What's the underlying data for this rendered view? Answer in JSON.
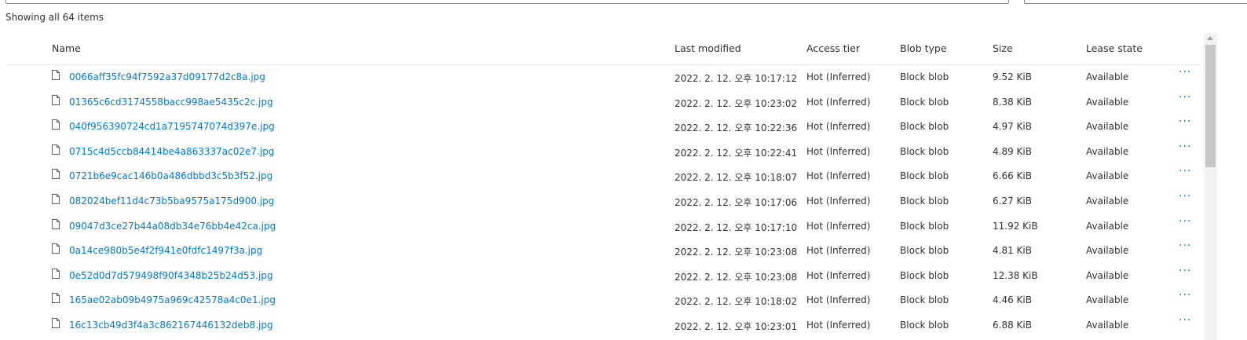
{
  "summary": "Showing all 64 items",
  "columns": {
    "name": "Name",
    "last_modified": "Last modified",
    "access_tier": "Access tier",
    "blob_type": "Blob type",
    "size": "Size",
    "lease_state": "Lease state"
  },
  "rows": [
    {
      "name": "0066aff35fc94f7592a37d09177d2c8a.jpg",
      "modified": "2022. 2. 12. 오후 10:17:12",
      "tier": "Hot (Inferred)",
      "type": "Block blob",
      "size": "9.52 KiB",
      "lease": "Available",
      "more": "···"
    },
    {
      "name": "01365c6cd3174558bacc998ae5435c2c.jpg",
      "modified": "2022. 2. 12. 오후 10:23:02",
      "tier": "Hot (Inferred)",
      "type": "Block blob",
      "size": "8.38 KiB",
      "lease": "Available",
      "more": "···"
    },
    {
      "name": "040f956390724cd1a7195747074d397e.jpg",
      "modified": "2022. 2. 12. 오후 10:22:36",
      "tier": "Hot (Inferred)",
      "type": "Block blob",
      "size": "4.97 KiB",
      "lease": "Available",
      "more": "···"
    },
    {
      "name": "0715c4d5ccb84414be4a863337ac02e7.jpg",
      "modified": "2022. 2. 12. 오후 10:22:41",
      "tier": "Hot (Inferred)",
      "type": "Block blob",
      "size": "4.89 KiB",
      "lease": "Available",
      "more": "···"
    },
    {
      "name": "0721b6e9cac146b0a486dbbd3c5b3f52.jpg",
      "modified": "2022. 2. 12. 오후 10:18:07",
      "tier": "Hot (Inferred)",
      "type": "Block blob",
      "size": "6.66 KiB",
      "lease": "Available",
      "more": "···"
    },
    {
      "name": "082024bef11d4c73b5ba9575a175d900.jpg",
      "modified": "2022. 2. 12. 오후 10:17:06",
      "tier": "Hot (Inferred)",
      "type": "Block blob",
      "size": "6.27 KiB",
      "lease": "Available",
      "more": "···"
    },
    {
      "name": "09047d3ce27b44a08db34e76bb4e42ca.jpg",
      "modified": "2022. 2. 12. 오후 10:17:10",
      "tier": "Hot (Inferred)",
      "type": "Block blob",
      "size": "11.92 KiB",
      "lease": "Available",
      "more": "···"
    },
    {
      "name": "0a14ce980b5e4f2f941e0fdfc1497f3a.jpg",
      "modified": "2022. 2. 12. 오후 10:23:08",
      "tier": "Hot (Inferred)",
      "type": "Block blob",
      "size": "4.81 KiB",
      "lease": "Available",
      "more": "···"
    },
    {
      "name": "0e52d0d7d579498f90f4348b25b24d53.jpg",
      "modified": "2022. 2. 12. 오후 10:23:08",
      "tier": "Hot (Inferred)",
      "type": "Block blob",
      "size": "12.38 KiB",
      "lease": "Available",
      "more": "···"
    },
    {
      "name": "165ae02ab09b4975a969c42578a4c0e1.jpg",
      "modified": "2022. 2. 12. 오후 10:18:02",
      "tier": "Hot (Inferred)",
      "type": "Block blob",
      "size": "4.46 KiB",
      "lease": "Available",
      "more": "···"
    },
    {
      "name": "16c13cb49d3f4a3c862167446132deb8.jpg",
      "modified": "2022. 2. 12. 오후 10:23:01",
      "tier": "Hot (Inferred)",
      "type": "Block blob",
      "size": "6.88 KiB",
      "lease": "Available",
      "more": "···"
    }
  ],
  "icons": {
    "file": "file-icon",
    "more": "more-icon"
  },
  "colors": {
    "link": "#0078d4",
    "text": "#323130",
    "divider": "#edebe9",
    "scrollbar_track": "#f3f2f1",
    "scrollbar_thumb": "#c8c6c4"
  }
}
